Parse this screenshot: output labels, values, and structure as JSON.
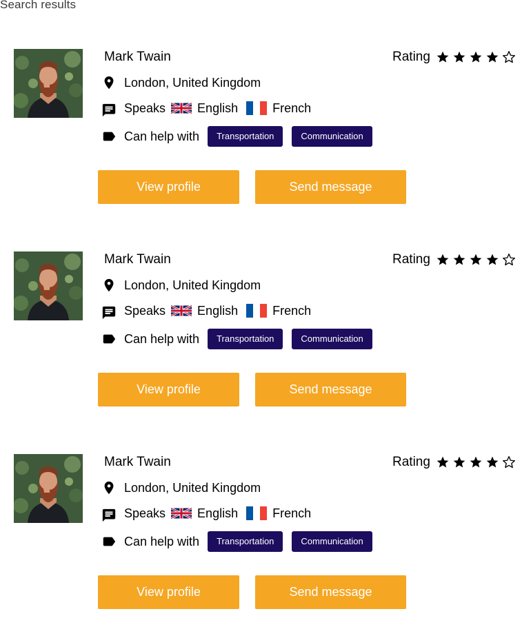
{
  "page": {
    "heading": "Search results"
  },
  "results": [
    {
      "name": "Mark Twain",
      "rating_label": "Rating",
      "rating": 4,
      "rating_max": 5,
      "location": "London, United Kingdom",
      "speaks_label": "Speaks",
      "languages": [
        {
          "name": "English",
          "flag": "uk-flag"
        },
        {
          "name": "French",
          "flag": "fr-flag"
        }
      ],
      "help_label": "Can help with",
      "tags": [
        "Transportation",
        "Communication"
      ],
      "view_button": "View profile",
      "message_button": "Send message"
    },
    {
      "name": "Mark Twain",
      "rating_label": "Rating",
      "rating": 4,
      "rating_max": 5,
      "location": "London, United Kingdom",
      "speaks_label": "Speaks",
      "languages": [
        {
          "name": "English",
          "flag": "uk-flag"
        },
        {
          "name": "French",
          "flag": "fr-flag"
        }
      ],
      "help_label": "Can help with",
      "tags": [
        "Transportation",
        "Communication"
      ],
      "view_button": "View profile",
      "message_button": "Send message"
    },
    {
      "name": "Mark Twain",
      "rating_label": "Rating",
      "rating": 4,
      "rating_max": 5,
      "location": "London, United Kingdom",
      "speaks_label": "Speaks",
      "languages": [
        {
          "name": "English",
          "flag": "uk-flag"
        },
        {
          "name": "French",
          "flag": "fr-flag"
        }
      ],
      "help_label": "Can help with",
      "tags": [
        "Transportation",
        "Communication"
      ],
      "view_button": "View profile",
      "message_button": "Send message"
    }
  ],
  "colors": {
    "button": "#f5a623",
    "tag": "#1d0d5e",
    "text": "#000000"
  },
  "icons": {
    "location": "location-pin-icon",
    "speaks": "chat-bubble-icon",
    "help": "label-tag-icon",
    "star_filled": "star-filled-icon",
    "star_empty": "star-outline-icon"
  }
}
